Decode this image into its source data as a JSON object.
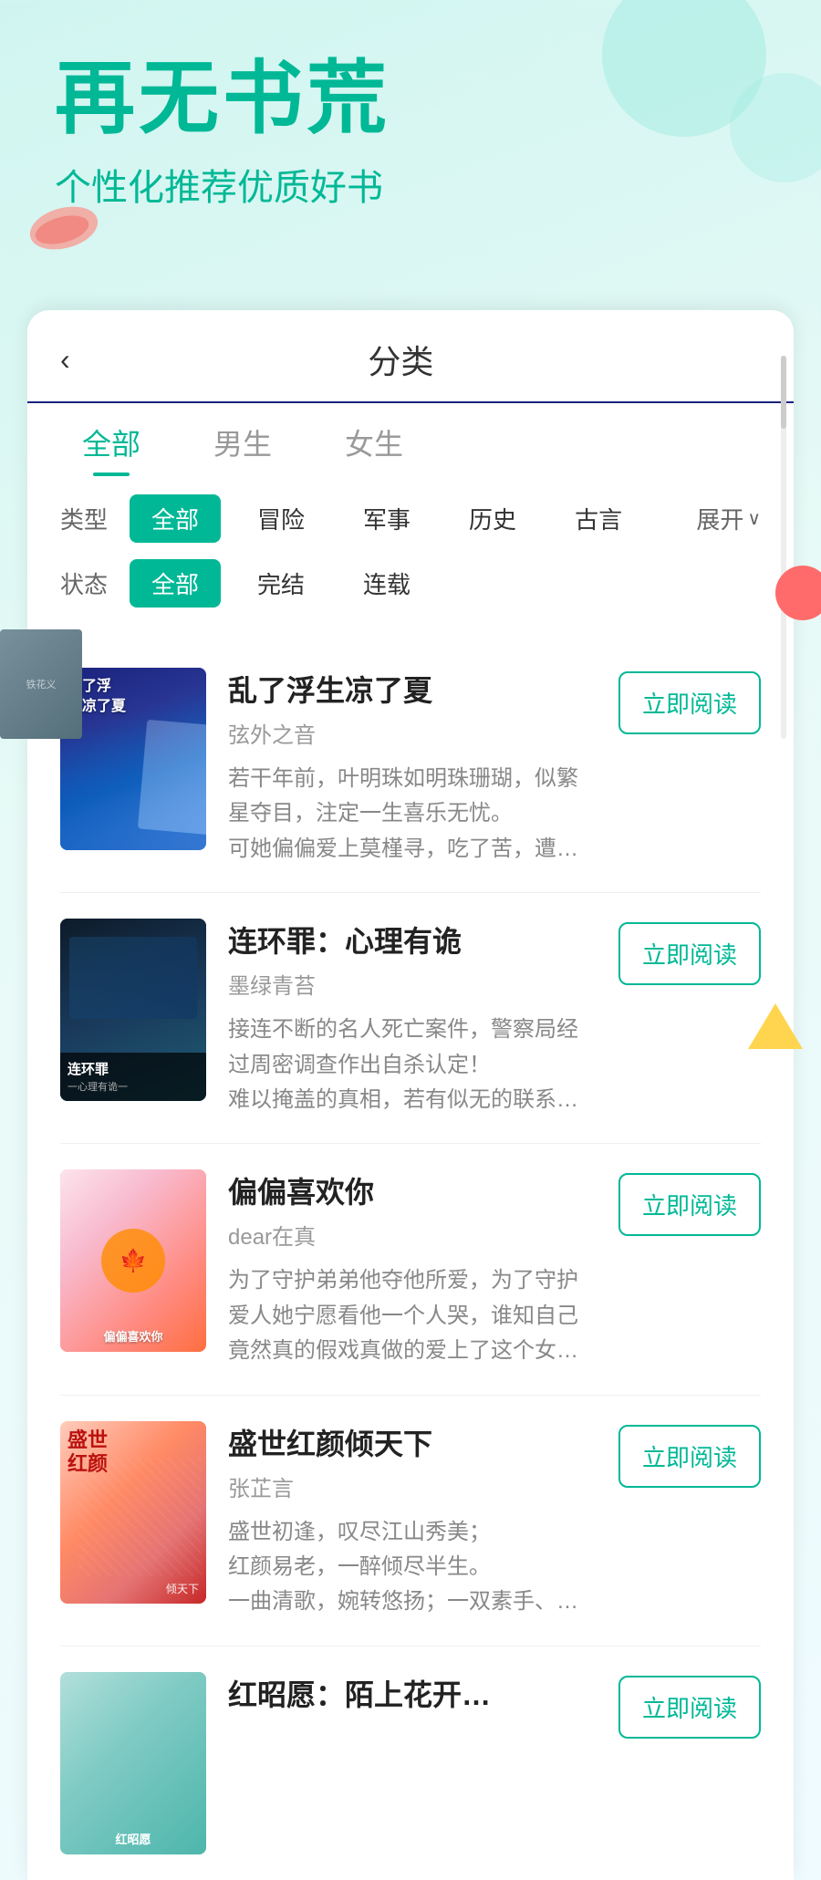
{
  "hero": {
    "title": "再无书荒",
    "subtitle": "个性化推荐优质好书"
  },
  "panel": {
    "back_label": "‹",
    "title": "分类",
    "tabs": [
      {
        "label": "全部",
        "active": true
      },
      {
        "label": "男生",
        "active": false
      },
      {
        "label": "女生",
        "active": false
      }
    ],
    "filters": {
      "type": {
        "label": "类型",
        "tags": [
          {
            "label": "全部",
            "active": true
          },
          {
            "label": "冒险",
            "active": false
          },
          {
            "label": "军事",
            "active": false
          },
          {
            "label": "历史",
            "active": false
          },
          {
            "label": "古言",
            "active": false
          }
        ],
        "expand_label": "展开",
        "expand_icon": "❯"
      },
      "status": {
        "label": "状态",
        "tags": [
          {
            "label": "全部",
            "active": true
          },
          {
            "label": "完结",
            "active": false
          },
          {
            "label": "连载",
            "active": false
          }
        ]
      }
    },
    "books": [
      {
        "title": "乱了浮生凉了夏",
        "author": "弦外之音",
        "desc": "若干年前，叶明珠如明珠珊瑚，似繁星夺目，注定一生喜乐无忧。\n可她偏偏爱上莫槿寻，吃了苦，遭了难，容颜尽毁，骨肉分离，…",
        "read_btn": "立即阅读",
        "cover_type": "cover-1"
      },
      {
        "title": "连环罪：心理有诡",
        "author": "墨绿青苔",
        "desc": "接连不断的名人死亡案件，警察局经过周密调查作出自杀认定！\n难以掩盖的真相，若有似无的联系，诱引着警察暗中追踪。…",
        "read_btn": "立即阅读",
        "cover_type": "cover-2"
      },
      {
        "title": "偏偏喜欢你",
        "author": "dear在真",
        "desc": "为了守护弟弟他夺他所爱，为了守护爱人她宁愿看他一个人哭，谁知自己竟然真的假戏真做的爱上了这个女生，亲情和爱情难以割舍。六年的时间里或许真的也能改变什么、一直等待着爱情的…",
        "read_btn": "立即阅读",
        "cover_type": "cover-3"
      },
      {
        "title": "盛世红颜倾天下",
        "author": "张芷言",
        "desc": "盛世初逢，叹尽江山秀美；\n红颜易老，一醉倾尽半生。\n一曲清歌，婉转悠扬；一双素手、十指纤纤。…",
        "read_btn": "立即阅读",
        "cover_type": "cover-4"
      },
      {
        "title": "红昭愿：陌上花开…",
        "author": "",
        "desc": "",
        "read_btn": "立即阅读",
        "cover_type": "cover-5"
      }
    ]
  }
}
